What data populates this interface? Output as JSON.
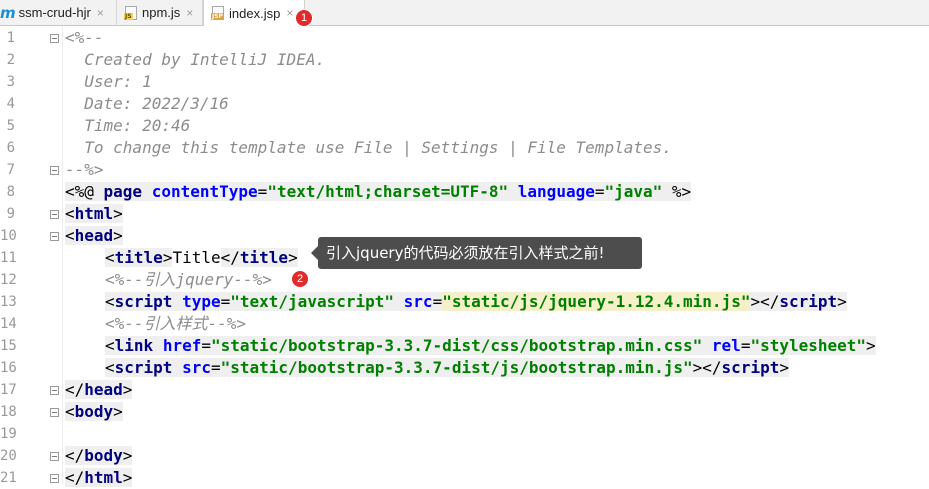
{
  "tabs": [
    {
      "label": "ssm-crud-hjr",
      "close": "×",
      "icon": "maven-icon",
      "icon_text": "m"
    },
    {
      "label": "npm.js",
      "close": "×",
      "icon": "js-file-icon",
      "icon_text": "JS"
    },
    {
      "label": "index.jsp",
      "close": "×",
      "icon": "jsp-file-icon",
      "icon_text": "JSP",
      "active": true
    }
  ],
  "badges": {
    "one": "1",
    "two": "2"
  },
  "tooltip": "引入jquery的代码必须放在引入样式之前!",
  "line_numbers": [
    "1",
    "2",
    "3",
    "4",
    "5",
    "6",
    "7",
    "8",
    "9",
    "10",
    "11",
    "12",
    "13",
    "14",
    "15",
    "16",
    "17",
    "18",
    "19",
    "20",
    "21"
  ],
  "code": {
    "l1": "<%--",
    "l2": "  Created by IntelliJ IDEA.",
    "l3": "  User: 1",
    "l4": "  Date: 2022/3/16",
    "l5": "  Time: 20:46",
    "l6": "  To change this template use File | Settings | File Templates.",
    "l7": "--%>",
    "l8": {
      "open": "<%@ ",
      "page": "page",
      "ct_attr": "contentType",
      "eq1": "=",
      "ct_val": "\"text/html;charset=UTF-8\"",
      "lang_attr": "language",
      "eq2": "=",
      "lang_val": "\"java\"",
      "close": " %>"
    },
    "l9": {
      "lt": "<",
      "name": "html",
      "gt": ">"
    },
    "l10": {
      "lt": "<",
      "name": "head",
      "gt": ">"
    },
    "l11": {
      "open_lt": "<",
      "open_name": "title",
      "open_gt": ">",
      "text": "Title",
      "close_lt": "</",
      "close_name": "title",
      "close_gt": ">"
    },
    "l12": "<%--引入jquery--%>",
    "l13": {
      "lt": "<",
      "name": "script",
      "type_attr": "type",
      "eq1": "=",
      "type_val": "\"text/javascript\"",
      "src_attr": "src",
      "eq2": "=",
      "src_val": "\"static/js/jquery-1.12.4.min.js\"",
      "gt": ">",
      "close_lt": "</",
      "close_name": "script",
      "close_gt": ">"
    },
    "l14": "<%--引入样式--%>",
    "l15": {
      "lt": "<",
      "name": "link",
      "href_attr": "href",
      "eq1": "=",
      "href_val": "\"static/bootstrap-3.3.7-dist/css/bootstrap.min.css\"",
      "rel_attr": "rel",
      "eq2": "=",
      "rel_val": "\"stylesheet\"",
      "gt": ">"
    },
    "l16": {
      "lt": "<",
      "name": "script",
      "src_attr": "src",
      "eq1": "=",
      "src_val": "\"static/bootstrap-3.3.7-dist/js/bootstrap.min.js\"",
      "gt": ">",
      "close_lt": "</",
      "close_name": "script",
      "close_gt": ">"
    },
    "l17": {
      "lt": "</",
      "name": "head",
      "gt": ">"
    },
    "l18": {
      "lt": "<",
      "name": "body",
      "gt": ">"
    },
    "l20": {
      "lt": "</",
      "name": "body",
      "gt": ">"
    },
    "l21": {
      "lt": "</",
      "name": "html",
      "gt": ">"
    }
  }
}
